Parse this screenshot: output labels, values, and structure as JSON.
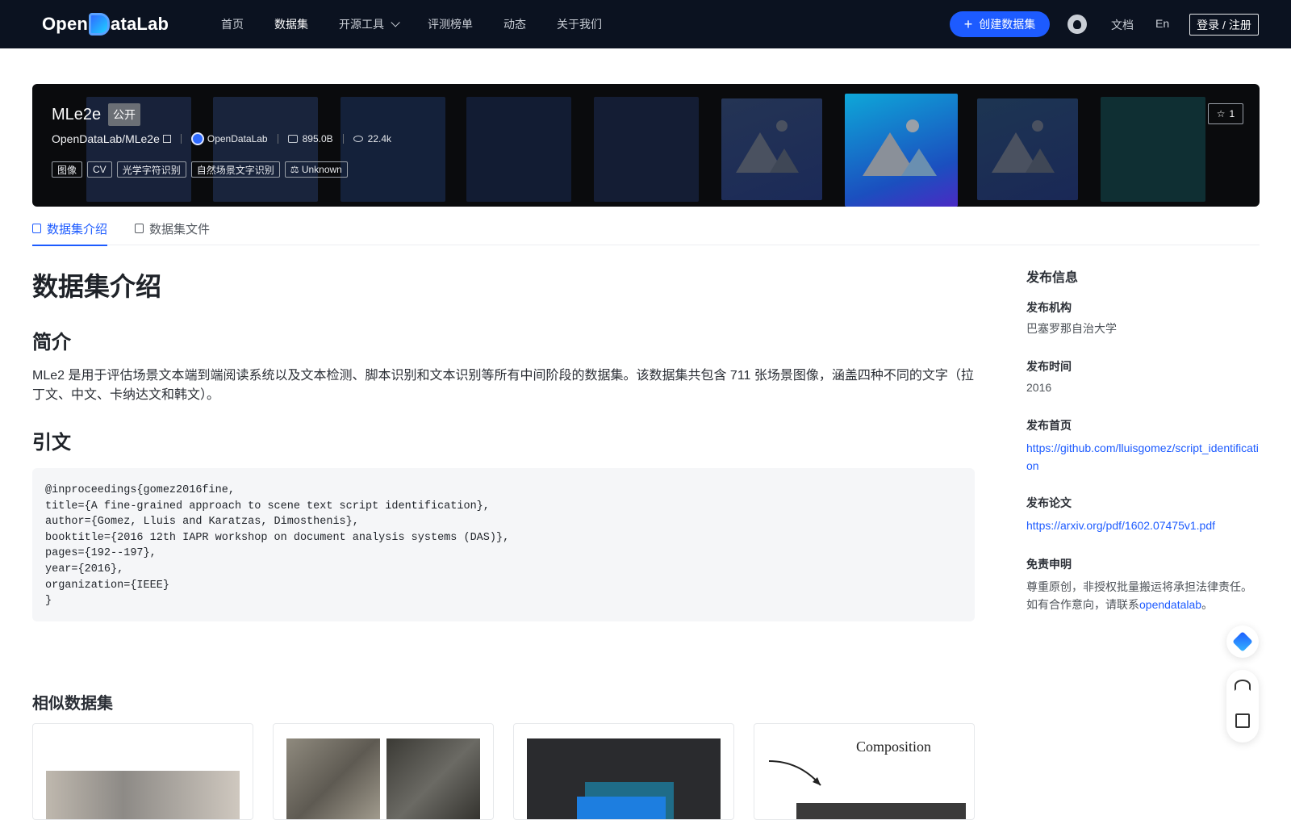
{
  "nav": {
    "logo": "OpenDataLab",
    "items": [
      {
        "label": "首页",
        "active": false
      },
      {
        "label": "数据集",
        "active": true
      },
      {
        "label": "开源工具",
        "active": false,
        "has_dropdown": true
      },
      {
        "label": "评测榜单",
        "active": false
      },
      {
        "label": "动态",
        "active": false
      },
      {
        "label": "关于我们",
        "active": false
      }
    ],
    "create_label": "创建数据集",
    "docs_label": "文档",
    "lang_label": "En",
    "login_label": "登录 / 注册"
  },
  "hero": {
    "title": "MLe2e",
    "badge": "公开",
    "path": "OpenDataLab/MLe2e",
    "org": "OpenDataLab",
    "size": "895.0B",
    "views": "22.4k",
    "star_count": "1",
    "tags": [
      "图像",
      "CV",
      "光学字符识别",
      "自然场景文字识别",
      "Unknown"
    ]
  },
  "tabs": [
    {
      "label": "数据集介绍",
      "active": true
    },
    {
      "label": "数据集文件",
      "active": false
    }
  ],
  "content": {
    "heading": "数据集介绍",
    "intro_heading": "简介",
    "intro_text": "MLe2 是用于评估场景文本端到端阅读系统以及文本检测、脚本识别和文本识别等所有中间阶段的数据集。该数据集共包含 711 张场景图像，涵盖四种不同的文字（拉丁文、中文、卡纳达文和韩文）。",
    "citation_heading": "引文",
    "citation": "@inproceedings{gomez2016fine,\ntitle={A fine-grained approach to scene text script identification},\nauthor={Gomez, Lluis and Karatzas, Dimosthenis},\nbooktitle={2016 12th IAPR workshop on document analysis systems (DAS)},\npages={192--197},\nyear={2016},\norganization={IEEE}\n}"
  },
  "sidebar": {
    "title": "发布信息",
    "org_label": "发布机构",
    "org_value": "巴塞罗那自治大学",
    "time_label": "发布时间",
    "time_value": "2016",
    "home_label": "发布首页",
    "home_value": "https://github.com/lluisgomez/script_identification",
    "paper_label": "发布论文",
    "paper_value": "https://arxiv.org/pdf/1602.07475v1.pdf",
    "disclaimer_label": "免责申明",
    "disclaimer_text": "尊重原创，非授权批量搬运将承担法律责任。如有合作意向，请联系",
    "disclaimer_link": "opendatalab",
    "disclaimer_end": "。"
  },
  "similar": {
    "title": "相似数据集",
    "card4_caption": "Composition"
  },
  "colors": {
    "accent": "#1d5bff",
    "nav_bg": "#0b1220",
    "hero_bg": "#0a0b0d"
  }
}
